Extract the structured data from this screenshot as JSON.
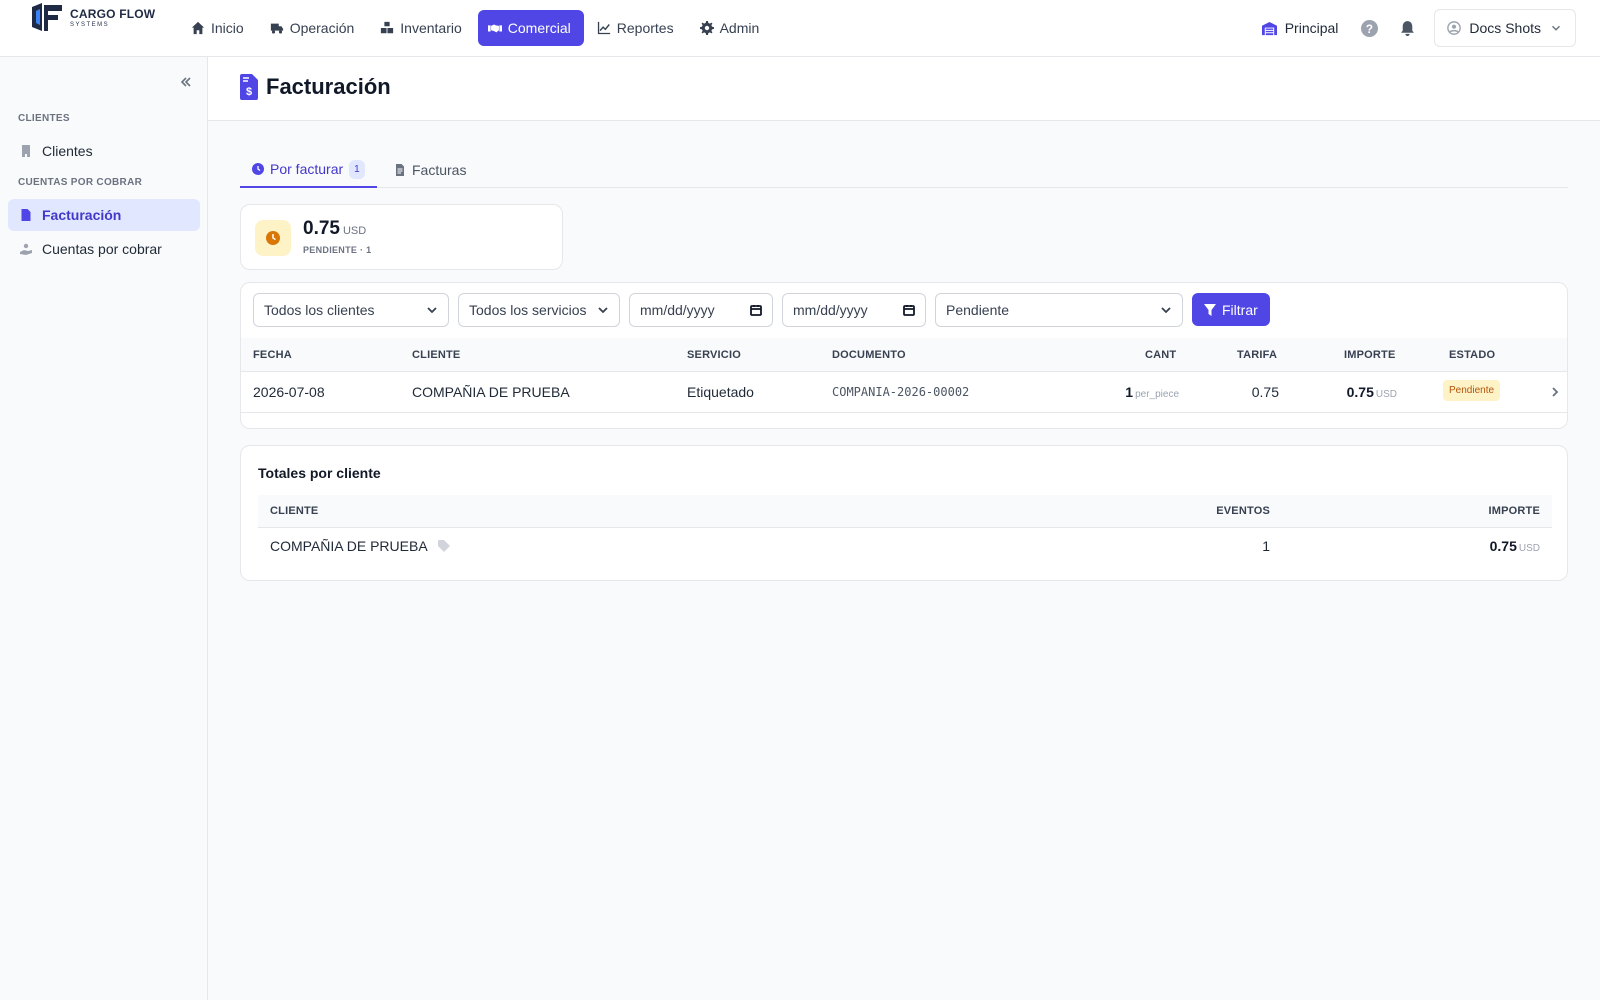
{
  "brand": {
    "name": "CARGO FLOW",
    "tagline": "SYSTEMS"
  },
  "nav": [
    {
      "label": "Inicio",
      "icon": "home-icon"
    },
    {
      "label": "Operación",
      "icon": "truck-icon"
    },
    {
      "label": "Inventario",
      "icon": "boxes-icon"
    },
    {
      "label": "Comercial",
      "icon": "handshake-icon",
      "active": true
    },
    {
      "label": "Reportes",
      "icon": "chart-line-icon"
    },
    {
      "label": "Admin",
      "icon": "gear-icon"
    }
  ],
  "topright": {
    "warehouse": "Principal",
    "user": "Docs Shots"
  },
  "sidebar": {
    "sections": [
      {
        "title": "CLIENTES",
        "items": [
          {
            "label": "Clientes",
            "icon": "building-icon"
          }
        ]
      },
      {
        "title": "CUENTAS POR COBRAR",
        "items": [
          {
            "label": "Facturación",
            "icon": "invoice-dollar-icon",
            "active": true
          },
          {
            "label": "Cuentas por cobrar",
            "icon": "hand-coin-icon"
          }
        ]
      }
    ]
  },
  "page": {
    "title": "Facturación"
  },
  "tabs": [
    {
      "label": "Por facturar",
      "count": "1",
      "active": true
    },
    {
      "label": "Facturas"
    }
  ],
  "stat": {
    "value": "0.75",
    "currency": "USD",
    "label": "PENDIENTE · 1"
  },
  "filters": {
    "client": "Todos los clientes",
    "service": "Todos los servicios",
    "date_from_placeholder": "mm/dd/yyyy",
    "date_to_placeholder": "mm/dd/yyyy",
    "status": "Pendiente",
    "button": "Filtrar"
  },
  "table": {
    "headers": [
      "FECHA",
      "CLIENTE",
      "SERVICIO",
      "DOCUMENTO",
      "CANT",
      "TARIFA",
      "IMPORTE",
      "ESTADO"
    ],
    "rows": [
      {
        "fecha": "2026-07-08",
        "cliente": "COMPAÑIA DE PRUEBA",
        "servicio": "Etiquetado",
        "documento": "COMPANIA-2026-00002",
        "cant": "1",
        "unit": "per_piece",
        "tarifa": "0.75",
        "importe": "0.75",
        "currency": "USD",
        "estado": "Pendiente"
      }
    ]
  },
  "totals": {
    "title": "Totales por cliente",
    "headers": [
      "CLIENTE",
      "EVENTOS",
      "IMPORTE"
    ],
    "rows": [
      {
        "cliente": "COMPAÑIA DE PRUEBA",
        "eventos": "1",
        "importe": "0.75",
        "currency": "USD"
      }
    ]
  },
  "colors": {
    "accent": "#4f46e5",
    "pending_bg": "#fef3c7",
    "pending_fg": "#b45309"
  }
}
